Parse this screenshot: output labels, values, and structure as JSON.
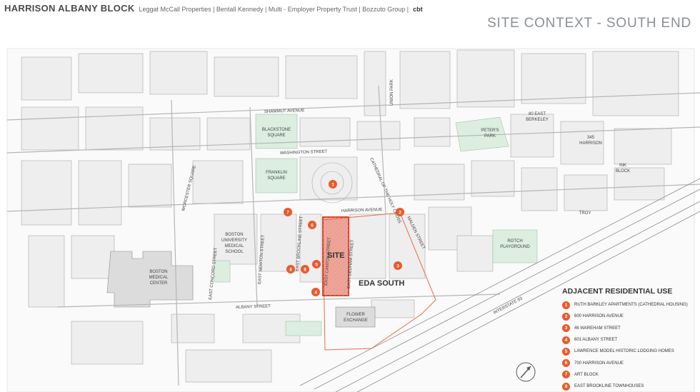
{
  "header": {
    "project": "HARRISON ALBANY BLOCK",
    "partners": "Leggat McCall Properties | Bentall Kennedy | Multi - Employer Property Trust | Bozzuto Group |",
    "firm": "cbt"
  },
  "sheet_title": "SITE CONTEXT - SOUTH END",
  "map": {
    "site_label": "SITE",
    "eda_label": "EDA SOUTH",
    "parks": {
      "blackstone": [
        "BLACKSTONE",
        "SQUARE"
      ],
      "franklin": [
        "FRANKLIN",
        "SQUARE"
      ],
      "peters": [
        "PETER'S",
        "PARK"
      ],
      "rotch": [
        "ROTCH",
        "PLAYGROUND"
      ],
      "worcester": "WORCESTER SQUARE",
      "union": "UNION PARK"
    },
    "places": {
      "east_berkeley": [
        "80 EAST",
        "BERKELEY"
      ],
      "harrison_345": [
        "345",
        "HARRISON"
      ],
      "ink_block": [
        "INK",
        "BLOCK"
      ],
      "troy": "TROY",
      "bu_medical_school": [
        "BOSTON",
        "UNIVERSITY",
        "MEDICAL",
        "SCHOOL"
      ],
      "bmc": [
        "BOSTON",
        "MEDICAL",
        "CENTER"
      ],
      "flower_exchange": [
        "FLOWER",
        "EXCHANGE"
      ],
      "cathedral": "CATHEDRAL OF THE HOLY CROSS"
    },
    "streets": {
      "shawmut": "SHAWMUT AVENUE",
      "washington": "WASHINGTON STREET",
      "harrison": "HARRISON AVENUE",
      "albany": "ALBANY STREET",
      "i93": "INTERSTATE 93",
      "east_newton": "EAST NEWTON STREET",
      "east_concord": "EAST CONCORD STREET",
      "east_brookline": "EAST BROOKLINE STREET",
      "east_canton": "EAST CANTON STREET",
      "east_dedham": "EAST DEDHAM STREET",
      "malden": "MALDEN STREET",
      "wareham": "WAREHAM ST"
    },
    "markers": [
      "1",
      "2",
      "3",
      "4",
      "5",
      "6",
      "7",
      "8"
    ]
  },
  "legend": {
    "title": "ADJACENT RESIDENTIAL USE",
    "items": [
      {
        "num": "1",
        "label": "RUTH BARKLEY APARTMENTS (CATHEDRAL HOUSING)"
      },
      {
        "num": "2",
        "label": "600 HARRISON AVENUE"
      },
      {
        "num": "3",
        "label": "46 WAREHAM STREET"
      },
      {
        "num": "4",
        "label": "601 ALBANY STREET"
      },
      {
        "num": "5",
        "label": "LAWRENCE MODEL HISTORIC LODGING HOMES"
      },
      {
        "num": "6",
        "label": "700 HARRISON AVENUE"
      },
      {
        "num": "7",
        "label": "ART BLOCK"
      },
      {
        "num": "8",
        "label": "EAST BROOKLINE TOWNHOUSES"
      }
    ]
  },
  "colors": {
    "site": "#e8533b",
    "marker": "#ea5a2b",
    "park": "#dbeee0",
    "building": "#eeeeee"
  }
}
